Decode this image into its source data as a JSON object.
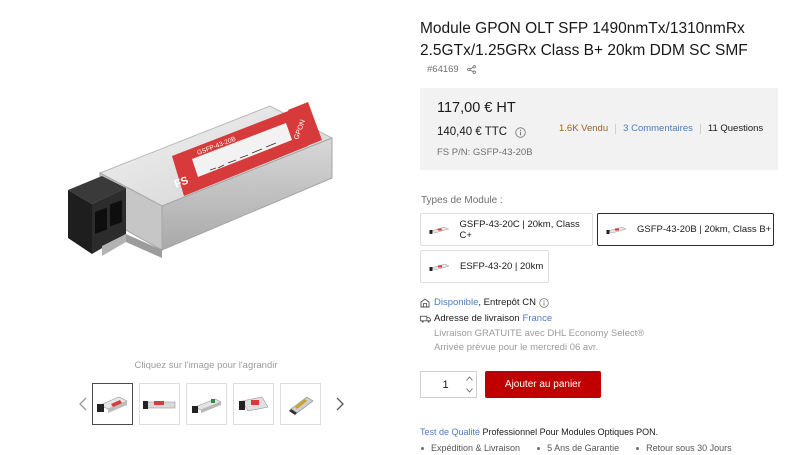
{
  "gallery": {
    "zoom_hint": "Cliquez sur l'image pour l'agrandir",
    "main_image": {
      "label_brand": "FS",
      "label_model": "GSFP-43-20B",
      "tab_text": "GPON"
    },
    "thumbnails": [
      {
        "name": "thumbnail-front",
        "active": true
      },
      {
        "name": "thumbnail-side",
        "active": false
      },
      {
        "name": "thumbnail-angle",
        "active": false
      },
      {
        "name": "thumbnail-top",
        "active": false
      },
      {
        "name": "thumbnail-connector",
        "active": false
      }
    ],
    "prev_icon": "chevron-left-icon",
    "next_icon": "chevron-right-icon"
  },
  "product": {
    "title": "Module GPON OLT SFP 1490nmTx/1310nmRx 2.5GTx/1.25GRx Class B+ 20km DDM SC SMF",
    "id": "#64169",
    "share_icon": "share-icon"
  },
  "price": {
    "ht": "117,00 € HT",
    "ttc": "140,40 € TTC",
    "pn": "FS P/N: GSFP-43-20B",
    "sold": "1.6K Vendu",
    "comments_count": "3",
    "comments_label": "Commentaires",
    "questions_count": "11",
    "questions_label": "Questions"
  },
  "variants": {
    "label": "Types de Module :",
    "options": [
      {
        "label": "GSFP-43-20C | 20km, Class C+",
        "selected": false
      },
      {
        "label": "GSFP-43-20B | 20km, Class B+",
        "selected": true
      },
      {
        "label": "ESFP-43-20 | 20km",
        "selected": false
      }
    ]
  },
  "stock": {
    "available": "Disponible",
    "warehouse": ", Entrepôt CN",
    "address_label": "Adresse de livraison",
    "country": "France",
    "free_shipping": "Livraison GRATUITE avec DHL Economy Select®",
    "eta": "Arrivée prévue pour le mercredi 06 avr."
  },
  "cart": {
    "quantity": "1",
    "button": "Ajouter au panier"
  },
  "quality": {
    "link": "Test de Qualité",
    "text": " Professionnel Pour Modules Optiques PON."
  },
  "features": [
    "Expédition & Livraison",
    "5 Ans de Garantie",
    "Retour sous 30 Jours"
  ],
  "colors": {
    "accent_red": "#c00000",
    "link_blue": "#4b7cc0",
    "sold_orange": "#9c6321",
    "price_bg": "#f2f2f2"
  }
}
